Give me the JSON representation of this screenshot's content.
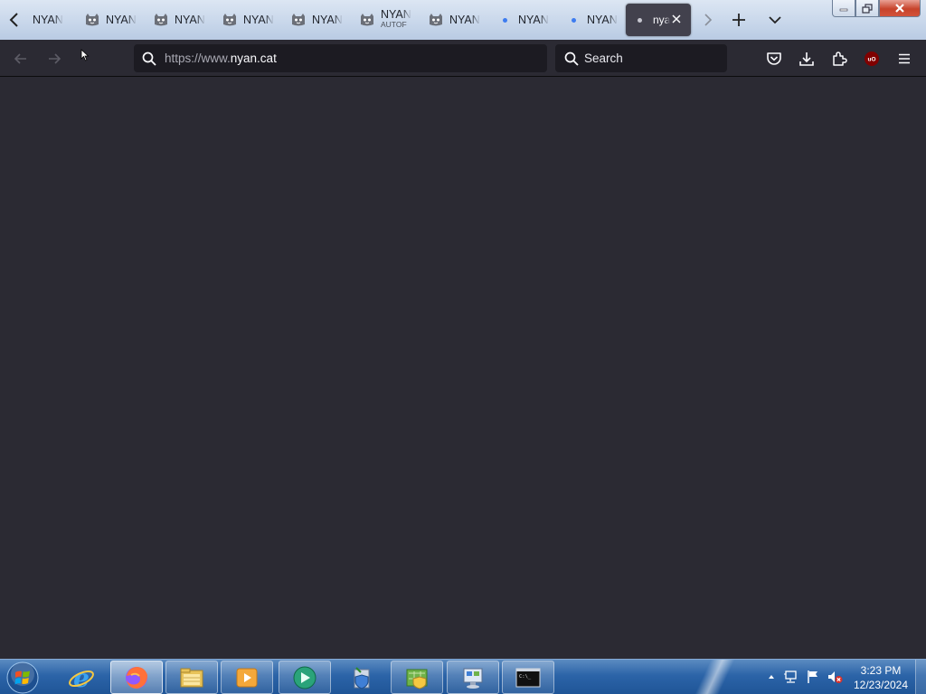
{
  "browser": {
    "tabs": [
      {
        "title": "NYAN",
        "favicon": "none"
      },
      {
        "title": "NYAN",
        "favicon": "cat-icon"
      },
      {
        "title": "NYAN",
        "favicon": "cat-icon"
      },
      {
        "title": "NYAN",
        "favicon": "cat-icon"
      },
      {
        "title": "NYAN",
        "favicon": "cat-icon"
      },
      {
        "title": "NYAN",
        "subtitle": "AUTOF",
        "favicon": "cat-icon"
      },
      {
        "title": "NYAN",
        "favicon": "cat-icon"
      },
      {
        "title": "NYAN",
        "favicon": "loading-dot-icon"
      },
      {
        "title": "NYAN",
        "favicon": "loading-dot-icon"
      },
      {
        "title": "nya",
        "favicon": "loading-dot-icon",
        "active": true
      }
    ],
    "url": {
      "prefix": "https://www.",
      "domain": "nyan.cat"
    },
    "search": {
      "placeholder": "Search"
    }
  },
  "taskbar": {
    "items": [
      "start-orb",
      "internet-explorer",
      "firefox",
      "file-explorer",
      "media-player",
      "media-center",
      "control-panel-shield",
      "network-map",
      "remote-desktop",
      "command-prompt"
    ],
    "clock": {
      "time": "3:23 PM",
      "date": "12/23/2024"
    }
  },
  "colors": {
    "content_bg": "#2b2a33",
    "toolbar_bg": "#2b2a33",
    "field_bg": "#1c1b22",
    "active_tab_bg": "#42414d",
    "taskbar_blue": "#2c64a8"
  }
}
